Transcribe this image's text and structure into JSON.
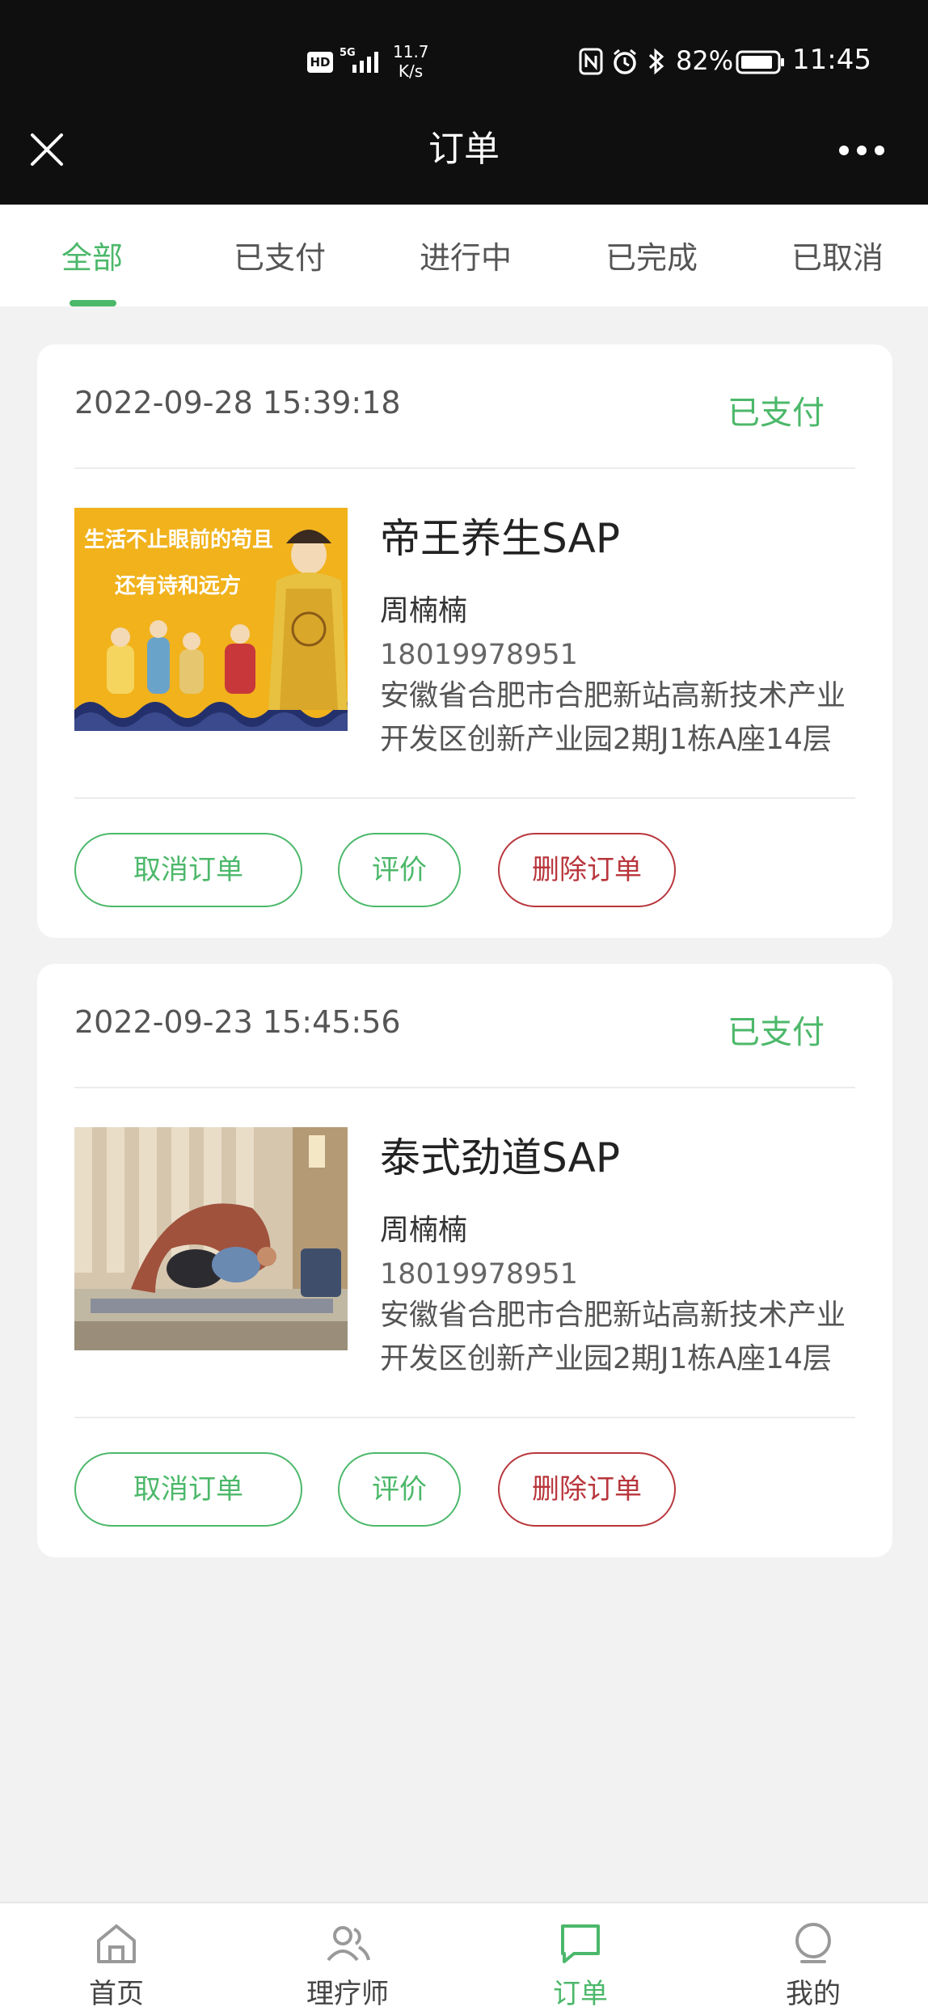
{
  "status_bar": {
    "hd": "HD",
    "network": "5G",
    "speed_value": "11.7",
    "speed_unit": "K/s",
    "battery": "82%",
    "time": "11:45"
  },
  "nav": {
    "title": "订单"
  },
  "tabs": [
    {
      "label": "全部",
      "active": true
    },
    {
      "label": "已支付",
      "active": false
    },
    {
      "label": "进行中",
      "active": false
    },
    {
      "label": "已完成",
      "active": false
    },
    {
      "label": "已取消",
      "active": false
    }
  ],
  "orders": [
    {
      "datetime": "2022-09-28 15:39:18",
      "status": "已支付",
      "service_name": "帝王养生SAP",
      "person": "周楠楠",
      "phone": "18019978951",
      "address_line1": "安徽省合肥市合肥新站高新技术产业",
      "address_line2": "开发区创新产业园2期J1栋A座14层",
      "image_text_1": "生活不止眼前的苟且",
      "image_text_2": "还有诗和远方",
      "buttons": {
        "cancel": "取消订单",
        "review": "评价",
        "delete": "删除订单"
      }
    },
    {
      "datetime": "2022-09-23 15:45:56",
      "status": "已支付",
      "service_name": "泰式劲道SAP",
      "person": "周楠楠",
      "phone": "18019978951",
      "address_line1": "安徽省合肥市合肥新站高新技术产业",
      "address_line2": "开发区创新产业园2期J1栋A座14层",
      "buttons": {
        "cancel": "取消订单",
        "review": "评价",
        "delete": "删除订单"
      }
    }
  ],
  "tabbar": [
    {
      "label": "首页",
      "icon": "home-icon",
      "active": false
    },
    {
      "label": "理疗师",
      "icon": "users-icon",
      "active": false
    },
    {
      "label": "订单",
      "icon": "chat-icon",
      "active": true
    },
    {
      "label": "我的",
      "icon": "profile-icon",
      "active": false
    }
  ],
  "colors": {
    "accent": "#4cb86a",
    "danger": "#b8363c",
    "header_bg": "#0f0f0f",
    "page_bg": "#f2f2f3"
  }
}
